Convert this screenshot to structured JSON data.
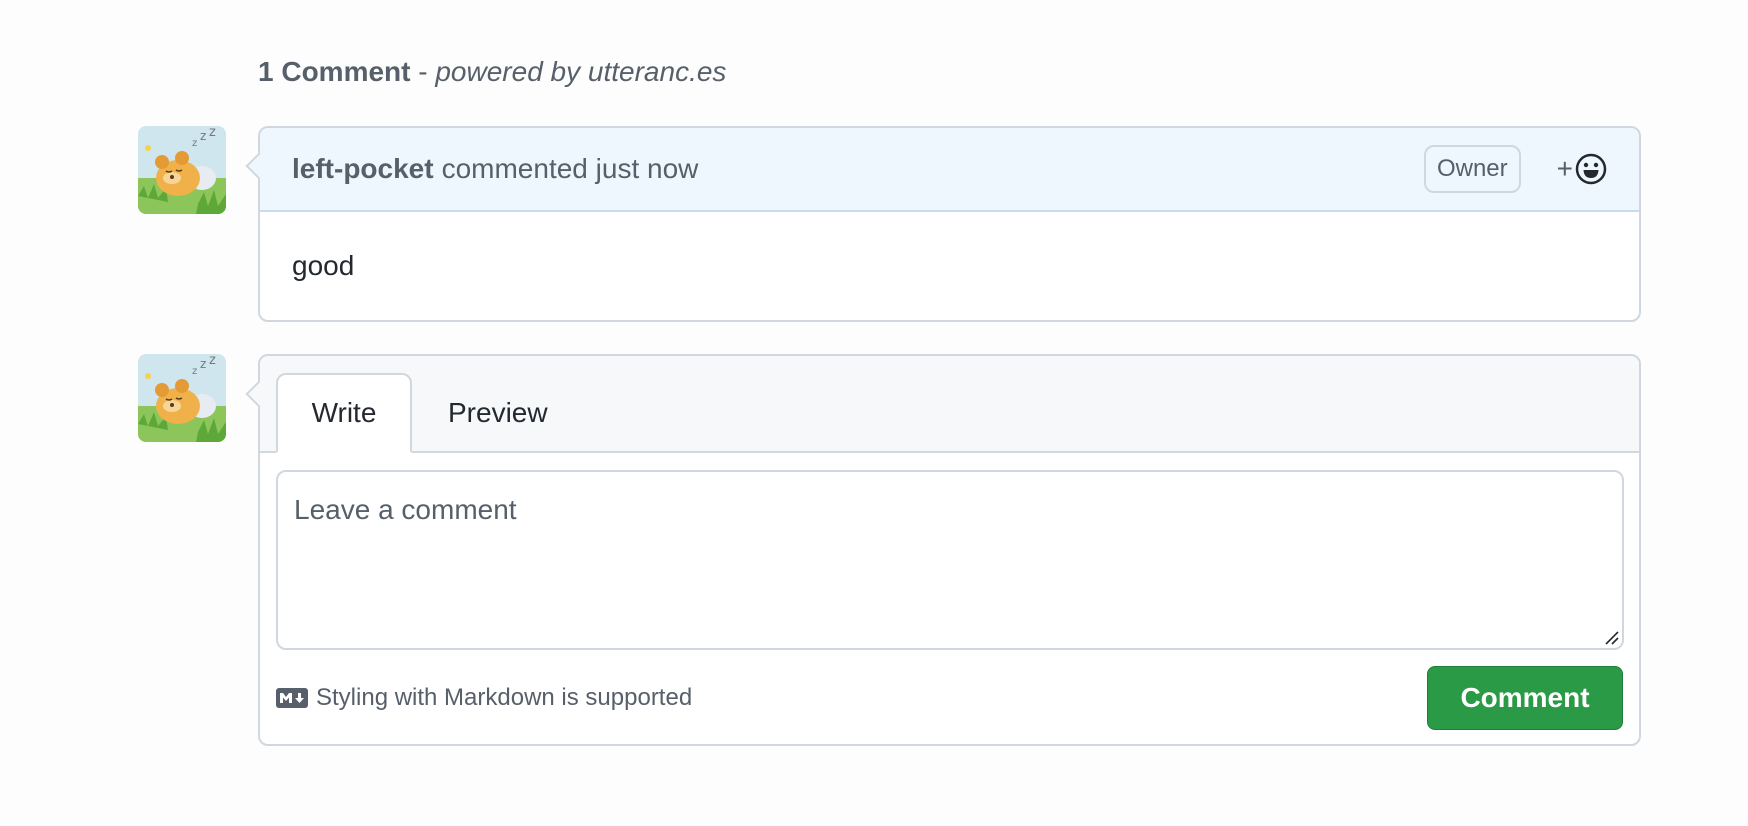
{
  "header": {
    "count_label": "1 Comment",
    "separator": " - ",
    "powered_by": "powered by utteranc.es"
  },
  "comment": {
    "author": "left-pocket",
    "action": "commented just now",
    "badge": "Owner",
    "reaction_plus": "+",
    "body": "good"
  },
  "form": {
    "tabs": [
      {
        "label": "Write",
        "active": true
      },
      {
        "label": "Preview",
        "active": false
      }
    ],
    "placeholder": "Leave a comment",
    "markdown_note": "Styling with Markdown is supported",
    "submit_label": "Comment"
  },
  "colors": {
    "accent_green": "#2a9a47",
    "header_blue": "#eef6fe",
    "border": "#d0d7de"
  },
  "icons": {
    "avatar": "sleeping-bear-avatar",
    "reaction": "smiley-icon",
    "markdown": "markdown-icon",
    "resize": "resize-handle-icon"
  }
}
